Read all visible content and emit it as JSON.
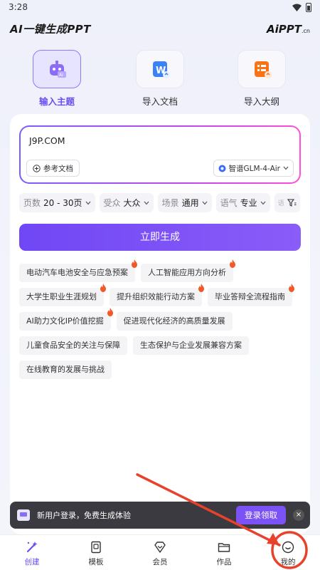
{
  "status": {
    "time": "3:28"
  },
  "header": {
    "title": "AI一键生成PPT",
    "brand_main": "PPT",
    "brand_prefix": "Ai",
    "brand_suffix": ".cn"
  },
  "modes": [
    {
      "label": "输入主题",
      "icon": "robot-icon",
      "active": true
    },
    {
      "label": "导入文档",
      "icon": "word-doc-icon",
      "active": false
    },
    {
      "label": "导入大纲",
      "icon": "outline-doc-icon",
      "active": false
    }
  ],
  "topic": {
    "value": "J9P.COM",
    "ref_doc_label": "参考文档",
    "model_label": "智谱GLM-4-Air"
  },
  "filters": [
    {
      "key": "页数",
      "value": "20 - 30页"
    },
    {
      "key": "受众",
      "value": "大众"
    },
    {
      "key": "场景",
      "value": "通用"
    },
    {
      "key": "语气",
      "value": "专业"
    },
    {
      "key": "语",
      "value": ""
    }
  ],
  "generate_label": "立即生成",
  "suggestions": [
    [
      {
        "text": "电动汽车电池安全与应急预案",
        "hot": true
      },
      {
        "text": "人工智能应用方向分析",
        "hot": true
      }
    ],
    [
      {
        "text": "大学生职业生涯规划",
        "hot": true
      },
      {
        "text": "提升组织效能行动方案",
        "hot": true
      },
      {
        "text": "毕业答辩全流程指南",
        "hot": true
      }
    ],
    [
      {
        "text": "AI助力文化IP价值挖掘",
        "hot": true
      },
      {
        "text": "促进现代化经济的高质量发展",
        "hot": false
      }
    ],
    [
      {
        "text": "儿童食品安全的关注与保障",
        "hot": false
      },
      {
        "text": "生态保护与企业发展兼容方案",
        "hot": false
      }
    ],
    [
      {
        "text": "在线教育的发展与挑战",
        "hot": false
      }
    ]
  ],
  "banner": {
    "text": "新用户登录，免费生成体验",
    "button": "登录领取",
    "close": "×"
  },
  "nav": [
    {
      "label": "创建",
      "icon": "magic-wand-icon",
      "active": true
    },
    {
      "label": "模板",
      "icon": "template-book-icon",
      "active": false
    },
    {
      "label": "会员",
      "icon": "diamond-icon",
      "active": false
    },
    {
      "label": "作品",
      "icon": "folder-icon",
      "active": false
    },
    {
      "label": "我的",
      "icon": "smile-face-icon",
      "active": false
    }
  ],
  "colors": {
    "accent": "#6c4df6",
    "annotation": "#e8412c"
  }
}
